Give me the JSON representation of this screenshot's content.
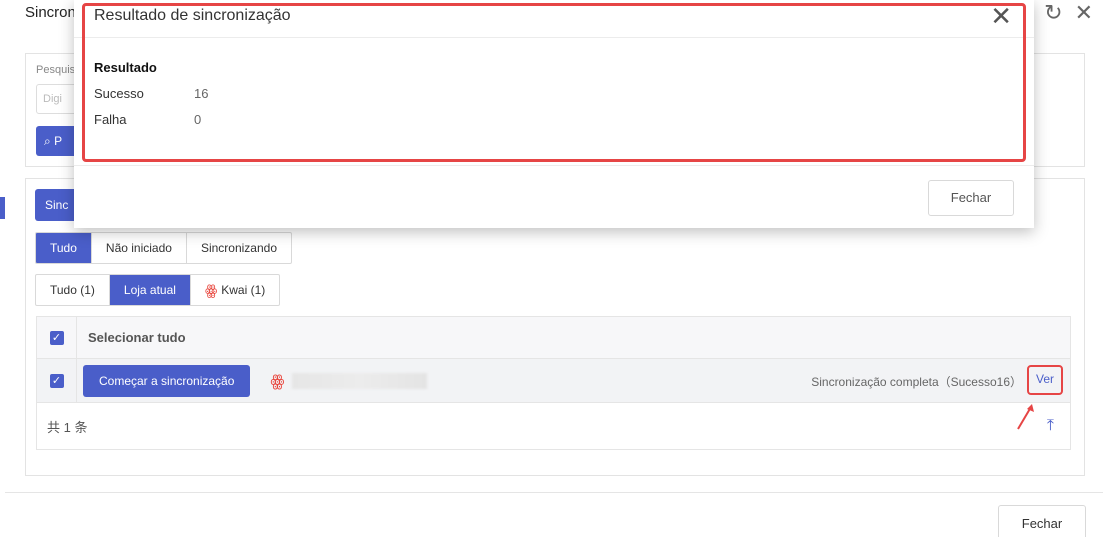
{
  "background": {
    "title": "Sincron",
    "search": {
      "label": "Pesquis",
      "placeholder": "Digi",
      "button_label": "P"
    },
    "sync_button_label": "Sinc",
    "status_tabs": [
      "Tudo",
      "Não iniciado",
      "Sincronizando"
    ],
    "status_active": "Tudo",
    "store_tabs": [
      "Tudo (1)",
      "Loja atual",
      "Kwai (1)"
    ],
    "store_active": "Loja atual",
    "table": {
      "select_all_label": "Selecionar tudo",
      "row": {
        "start_button_label": "Começar a sincronização",
        "status_text": "Sincronização completa（Sucesso16）",
        "view_link": "Ver"
      },
      "footer_count": "共 1 条"
    },
    "close_button_label": "Fechar"
  },
  "modal": {
    "title": "Resultado de sincronização",
    "result_heading": "Resultado",
    "rows": [
      {
        "label": "Sucesso",
        "value": "16"
      },
      {
        "label": "Falha",
        "value": "0"
      }
    ],
    "close_button_label": "Fechar"
  },
  "colors": {
    "primary": "#4a5ec9",
    "highlight": "#e64545",
    "kwai": "#e8453c"
  }
}
